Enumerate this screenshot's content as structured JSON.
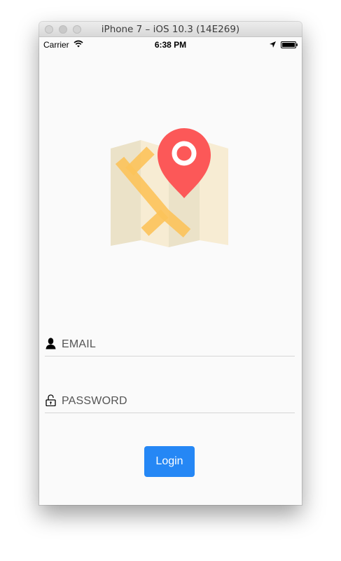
{
  "window": {
    "title": "iPhone 7 – iOS 10.3 (14E269)"
  },
  "status_bar": {
    "carrier": "Carrier",
    "time": "6:38 PM",
    "icons": [
      "wifi-icon",
      "location-icon",
      "battery-icon"
    ]
  },
  "logo": {
    "icon": "map-pin-icon",
    "colors": {
      "map_light": "#f7ecd3",
      "map_dark": "#e9e0c4",
      "road": "#fcc35a",
      "pin": "#fc5858"
    }
  },
  "form": {
    "email": {
      "label": "EMAIL",
      "icon": "user-icon"
    },
    "password": {
      "label": "PASSWORD",
      "icon": "unlocked-padlock-icon"
    },
    "login_label": "Login",
    "accent_color": "#2587f5"
  }
}
